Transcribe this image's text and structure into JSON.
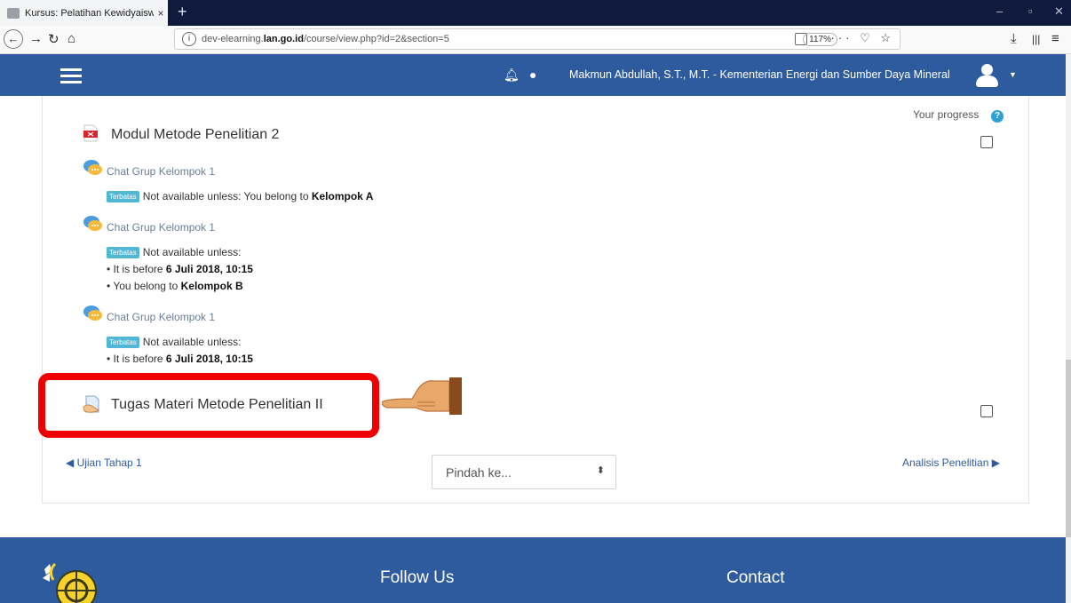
{
  "browser": {
    "tab_title": "Kursus: Pelatihan Kewidyaiswaran",
    "tab_close": "×",
    "new_tab": "+",
    "url_prefix": "dev-elearning.",
    "url_domain": "lan.go.id",
    "url_path": "/course/view.php?id=2&section=5",
    "zoom": "117%",
    "page_actions": "··· ♡ ☆",
    "win_min": "–",
    "win_max": "▫",
    "win_close": "✕"
  },
  "header": {
    "user_name": "Makmun Abdullah, S.T., M.T. - Kementerian Energi dan Sumber Daya Mineral"
  },
  "course": {
    "progress_label": "Your progress",
    "help": "?",
    "activities": [
      {
        "title": "Modul Metode Penelitian 2",
        "icon": "pdf-icon"
      },
      {
        "title": "Chat Grup Kelompok 1",
        "badge": "Terbatas",
        "restrict_intro": "Not available unless: You belong to ",
        "restrict_group": "Kelompok A"
      },
      {
        "title": "Chat Grup Kelompok 1",
        "badge": "Terbatas",
        "restrict_intro": "Not available unless:",
        "bullet1_pre": "• It is before ",
        "bullet1_bold": "6 Juli 2018, 10:15",
        "bullet2_pre": "• You belong to ",
        "bullet2_bold": "Kelompok B"
      },
      {
        "title": "Chat Grup Kelompok 1",
        "badge": "Terbatas",
        "restrict_intro": "Not available unless:",
        "bullet1_pre": "• It is before ",
        "bullet1_bold": "6 Juli 2018, 10:15"
      },
      {
        "title": "Tugas Materi Metode Penelitian II",
        "icon": "assignment-icon"
      }
    ]
  },
  "section_nav": {
    "prev": "◀ Ujian Tahap 1",
    "jump_placeholder": "Pindah ke...",
    "jump_arrow": "⬍",
    "next": "Analisis Penelitian ▶"
  },
  "footer": {
    "follow": "Follow Us",
    "contact": "Contact"
  },
  "colors": {
    "header_blue": "#2e5b9e",
    "badge_blue": "#52b6d5",
    "highlight_red": "#ee0000"
  }
}
